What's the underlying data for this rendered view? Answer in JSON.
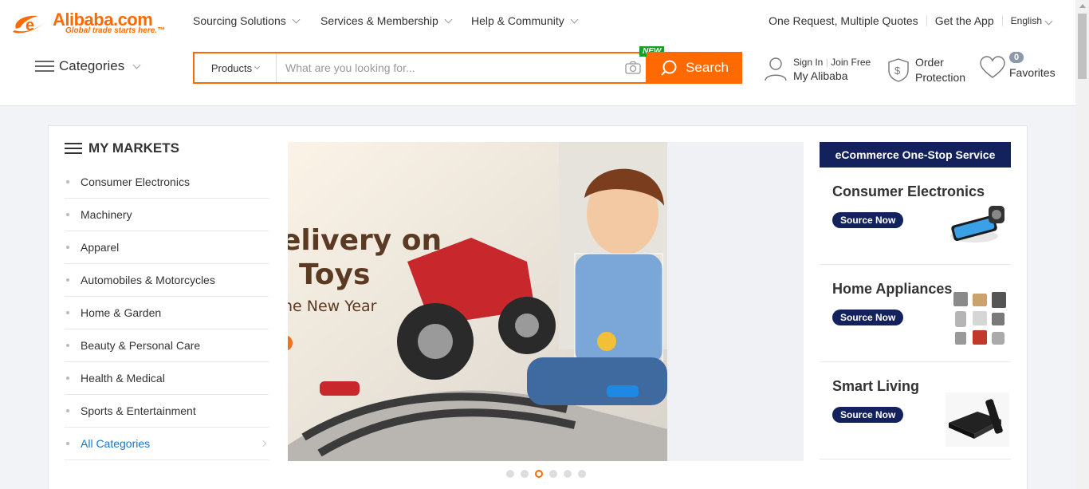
{
  "logo": {
    "brand": "Alibaba.com",
    "tagline": "Global trade starts here.™"
  },
  "topnav": {
    "items": [
      {
        "label": "Sourcing Solutions"
      },
      {
        "label": "Services & Membership"
      },
      {
        "label": "Help & Community"
      }
    ],
    "right": {
      "quotes": "One Request, Multiple Quotes",
      "app": "Get the App",
      "language": "English"
    }
  },
  "categories_label": "Categories",
  "search": {
    "type": "Products",
    "placeholder": "What are you looking for...",
    "button": "Search",
    "new_badge": "NEW"
  },
  "account": {
    "sign_in": "Sign In",
    "join": "Join Free",
    "my_alibaba": "My Alibaba",
    "order": "Order",
    "protection": "Protection",
    "favorites_count": "0",
    "favorites": "Favorites"
  },
  "markets": {
    "title": "MY MARKETS",
    "items": [
      "Consumer Electronics",
      "Machinery",
      "Apparel",
      "Automobiles & Motorcycles",
      "Home & Garden",
      "Beauty & Personal Care",
      "Health & Medical",
      "Sports & Entertainment"
    ],
    "all": "All Categories"
  },
  "banner": {
    "line1": "elivery on",
    "line2": "Toys",
    "line3": "ne New Year",
    "slide_count": 6,
    "active_slide": 3
  },
  "ecommerce": {
    "title": "eCommerce One-Stop Service",
    "cards": [
      {
        "title": "Consumer Electronics",
        "button": "Source Now"
      },
      {
        "title": "Home Appliances",
        "button": "Source Now"
      },
      {
        "title": "Smart Living",
        "button": "Source Now"
      }
    ]
  },
  "colors": {
    "accent": "#ff6a00",
    "navy": "#13225c",
    "link": "#1677c6"
  }
}
